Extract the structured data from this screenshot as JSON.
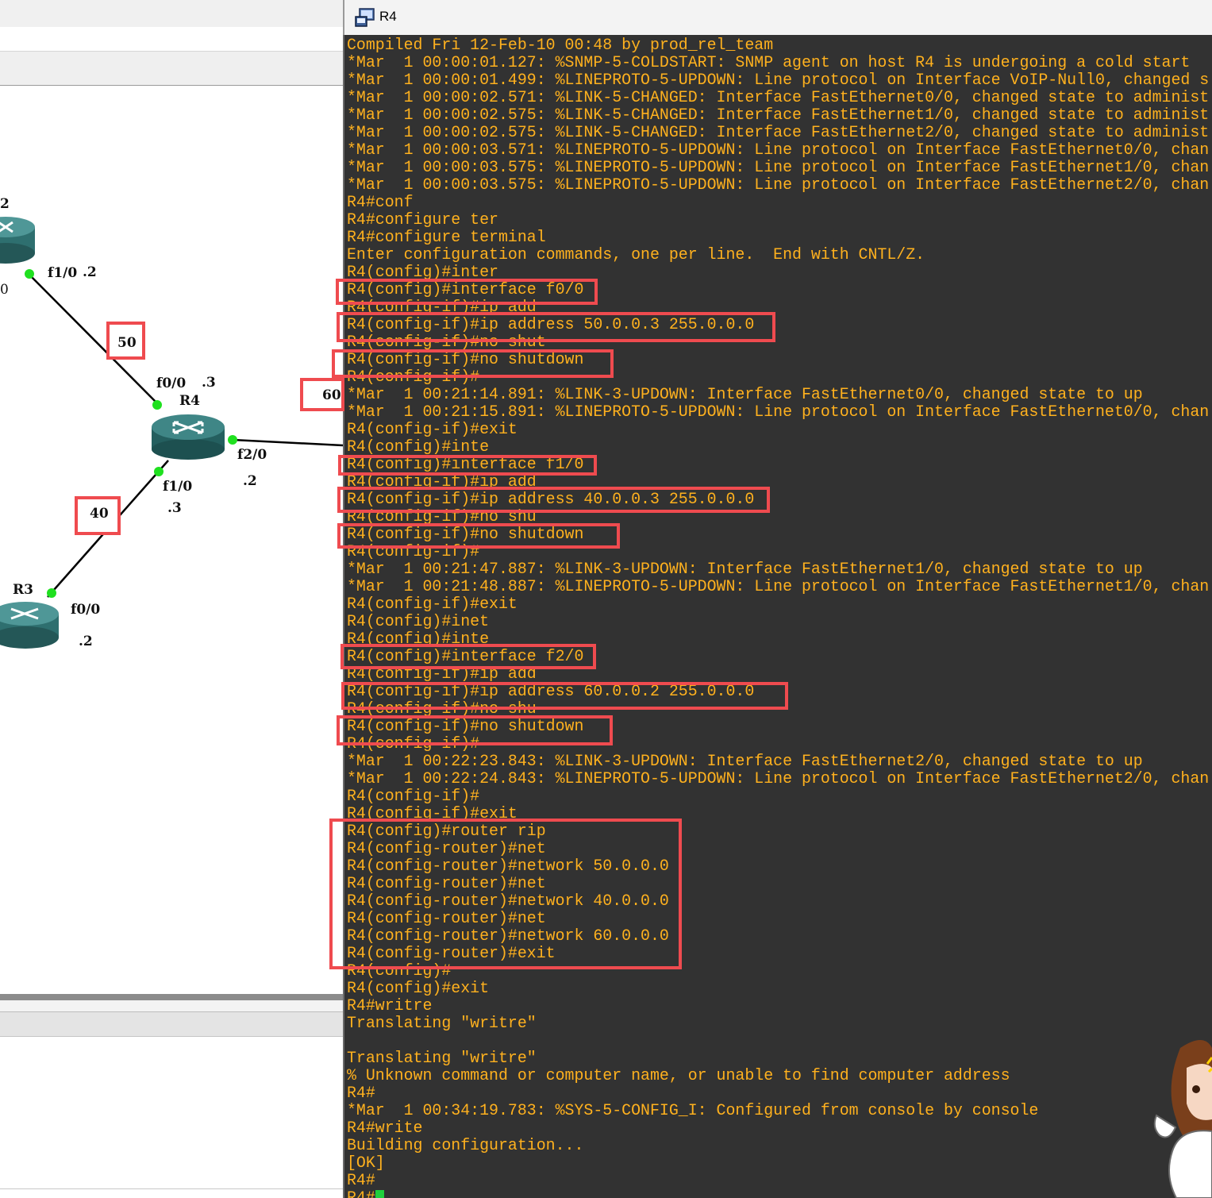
{
  "topology": {
    "routers": [
      {
        "id": "r2",
        "name": "2"
      },
      {
        "id": "r4",
        "name": "R4"
      },
      {
        "id": "r3",
        "name": "R3"
      }
    ],
    "labels": {
      "r2_f10": "f1/0",
      "r2_f10_host": ".2",
      "r2_left_iface": "0",
      "r4_f00": "f0/0",
      "r4_f00_host": ".3",
      "r4_f20": "f2/0",
      "r4_f20_host": ".2",
      "r4_f10": "f1/0",
      "r4_f10_host": ".3",
      "r3_f00": "f0/0",
      "r3_f00_host": ".2"
    },
    "network_boxes": [
      "50",
      "60",
      "40"
    ],
    "colors": {
      "port_dot": "#1fe01f",
      "router_body": "#2e6f6f",
      "highlight": "#ef4b4f"
    }
  },
  "terminal": {
    "window_title": "R4",
    "title_icon": "terminal-window-icon",
    "lines": [
      "Compiled Fri 12-Feb-10 00:48 by prod_rel_team",
      "*Mar  1 00:00:01.127: %SNMP-5-COLDSTART: SNMP agent on host R4 is undergoing a cold start",
      "*Mar  1 00:00:01.499: %LINEPROTO-5-UPDOWN: Line protocol on Interface VoIP-Null0, changed s",
      "*Mar  1 00:00:02.571: %LINK-5-CHANGED: Interface FastEthernet0/0, changed state to administ",
      "*Mar  1 00:00:02.575: %LINK-5-CHANGED: Interface FastEthernet1/0, changed state to administ",
      "*Mar  1 00:00:02.575: %LINK-5-CHANGED: Interface FastEthernet2/0, changed state to administ",
      "*Mar  1 00:00:03.571: %LINEPROTO-5-UPDOWN: Line protocol on Interface FastEthernet0/0, chan",
      "*Mar  1 00:00:03.575: %LINEPROTO-5-UPDOWN: Line protocol on Interface FastEthernet1/0, chan",
      "*Mar  1 00:00:03.575: %LINEPROTO-5-UPDOWN: Line protocol on Interface FastEthernet2/0, chan",
      "R4#conf",
      "R4#configure ter",
      "R4#configure terminal",
      "Enter configuration commands, one per line.  End with CNTL/Z.",
      "R4(config)#inter",
      "R4(config)#interface f0/0",
      "R4(config-if)#ip add",
      "R4(config-if)#ip address 50.0.0.3 255.0.0.0",
      "R4(config-if)#no shut",
      "R4(config-if)#no shutdown",
      "R4(config-if)#",
      "*Mar  1 00:21:14.891: %LINK-3-UPDOWN: Interface FastEthernet0/0, changed state to up",
      "*Mar  1 00:21:15.891: %LINEPROTO-5-UPDOWN: Line protocol on Interface FastEthernet0/0, chan",
      "R4(config-if)#exit",
      "R4(config)#inte",
      "R4(config)#interface f1/0",
      "R4(config-if)#ip add",
      "R4(config-if)#ip address 40.0.0.3 255.0.0.0",
      "R4(config-if)#no shu",
      "R4(config-if)#no shutdown",
      "R4(config-if)#",
      "*Mar  1 00:21:47.887: %LINK-3-UPDOWN: Interface FastEthernet1/0, changed state to up",
      "*Mar  1 00:21:48.887: %LINEPROTO-5-UPDOWN: Line protocol on Interface FastEthernet1/0, chan",
      "R4(config-if)#exit",
      "R4(config)#inet",
      "R4(config)#inte",
      "R4(config)#interface f2/0",
      "R4(config-if)#ip add",
      "R4(config-if)#ip address 60.0.0.2 255.0.0.0",
      "R4(config-if)#no shu",
      "R4(config-if)#no shutdown",
      "R4(config-if)#",
      "*Mar  1 00:22:23.843: %LINK-3-UPDOWN: Interface FastEthernet2/0, changed state to up",
      "*Mar  1 00:22:24.843: %LINEPROTO-5-UPDOWN: Line protocol on Interface FastEthernet2/0, chan",
      "R4(config-if)#",
      "R4(config-if)#exit",
      "R4(config)#router rip",
      "R4(config-router)#net",
      "R4(config-router)#network 50.0.0.0",
      "R4(config-router)#net",
      "R4(config-router)#network 40.0.0.0",
      "R4(config-router)#net",
      "R4(config-router)#network 60.0.0.0",
      "R4(config-router)#exit",
      "R4(config)#",
      "R4(config)#exit",
      "R4#writre",
      "Translating \"writre\"",
      "",
      "Translating \"writre\"",
      "% Unknown command or computer name, or unable to find computer address",
      "R4#",
      "*Mar  1 00:34:19.783: %SYS-5-CONFIG_I: Configured from console by console",
      "R4#write",
      "Building configuration...",
      "[OK]",
      "R4#",
      "R4#"
    ]
  },
  "mascot": "anime-mascot-icon"
}
